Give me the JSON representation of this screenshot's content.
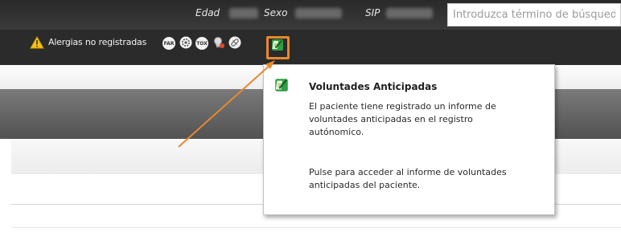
{
  "header": {
    "age_label": "Edad",
    "sex_label": "Sexo",
    "sip_label": "SIP",
    "search_placeholder": "Introduzca término de búsqueda"
  },
  "alerts": {
    "allergies_label": "Alergias no registradas",
    "icons": [
      {
        "name": "far-icon",
        "text": "FAR"
      },
      {
        "name": "settings-gear-icon"
      },
      {
        "name": "tox-icon",
        "text": "TOX"
      },
      {
        "name": "medal-icon"
      },
      {
        "name": "pill-icon"
      },
      {
        "name": "advance-directives-icon"
      }
    ]
  },
  "tooltip": {
    "title": "Voluntades Anticipadas",
    "paragraph1": "El paciente tiene registrado un informe de\nvoluntades anticipadas en el registro\nautónomico.",
    "paragraph2": "Pulse para acceder al informe de voluntades\nanticipadas del paciente."
  },
  "colors": {
    "highlight": "#e8892f",
    "header_bg": "#2b2b2b",
    "accent_line": "#e8a23a"
  }
}
